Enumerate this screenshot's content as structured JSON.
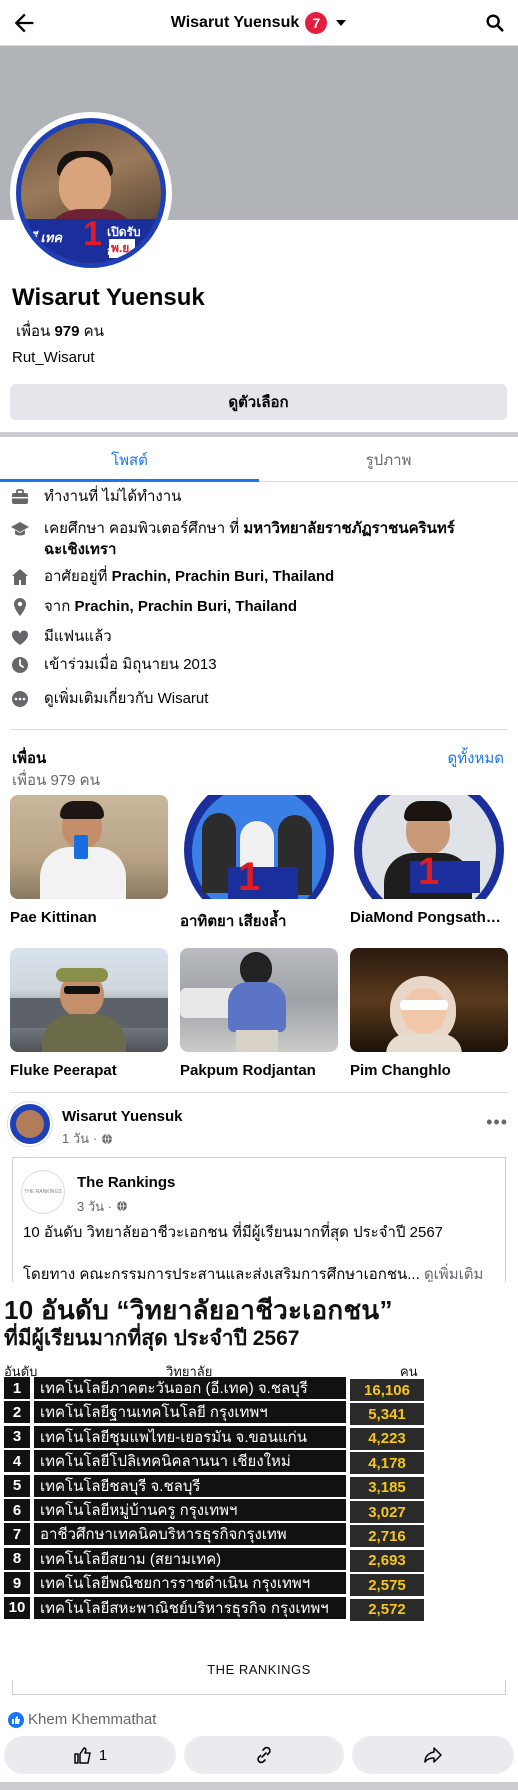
{
  "header": {
    "title": "Wisarut Yuensuk",
    "notification_count": "7"
  },
  "profile": {
    "name": "Wisarut Yuensuk",
    "friends_prefix": "เพื่อน",
    "friends_count": "979",
    "friends_suffix": "คน",
    "username": "Rut_Wisarut",
    "options_button": "ดูตัวเลือก",
    "avatar_banner": {
      "line1": "อี.เทค",
      "big": "1",
      "line2": "เปิดรับสมัคร",
      "line3": "พ.ย."
    }
  },
  "tabs": [
    {
      "label": "โพสต์",
      "active": true
    },
    {
      "label": "รูปภาพ",
      "active": false
    }
  ],
  "about": {
    "work": "ทำงานที่ ไม่ได้ทำงาน",
    "edu_prefix": "เคยศึกษา คอมพิวเตอร์ศึกษา ที่ ",
    "edu_school": "มหาวิทยาลัยราชภัฏราชนครินทร์ ฉะเชิงเทรา",
    "lives_prefix": "อาศัยอยู่ที่ ",
    "lives_place": "Prachin, Prachin Buri, Thailand",
    "from_prefix": "จาก ",
    "from_place": "Prachin, Prachin Buri, Thailand",
    "relationship": "มีแฟนแล้ว",
    "joined": "เข้าร่วมเมื่อ มิถุนายน 2013",
    "see_more": "ดูเพิ่มเติมเกี่ยวกับ Wisarut"
  },
  "friends_section": {
    "title": "เพื่อน",
    "count_text": "เพื่อน 979 คน",
    "see_all": "ดูทั้งหมด",
    "friends": [
      {
        "name": "Pae Kittinan"
      },
      {
        "name": "อาทิตยา เสียงล้ำ"
      },
      {
        "name": "DiaMond Pongsathorn"
      },
      {
        "name": "Fluke Peerapat"
      },
      {
        "name": "Pakpum Rodjantan"
      },
      {
        "name": "Pim Changhlo"
      }
    ]
  },
  "post": {
    "author": "Wisarut Yuensuk",
    "time": "1 วัน",
    "shared": {
      "author": "The Rankings",
      "time": "3 วัน",
      "avatar_text": "THE RANKINGS",
      "text1": "10 อันดับ วิทยาลัยอาชีวะเอกชน ที่มีผู้เรียนมากที่สุด ประจำปี 2567",
      "text2": "โดยทาง คณะกรรมการประสานและส่งเสริมการศึกษาเอกชน...",
      "see_more": "ดูเพิ่มเติม"
    },
    "image": {
      "heading1": "10 อันดับ “วิทยาลัยอาชีวะเอกชน”",
      "heading2": "ที่มีผู้เรียนมากที่สุด ประจำปี 2567",
      "col_rank": "อันดับ",
      "col_name": "วิทยาลัย",
      "col_count": "คน",
      "brand": "THE RANKINGS",
      "rows": [
        {
          "rank": "1",
          "name": "เทคโนโลยีภาคตะวันออก (อี.เทค) จ.ชลบุรี",
          "count": "16,106"
        },
        {
          "rank": "2",
          "name": "เทคโนโลยีฐานเทคโนโลยี กรุงเทพฯ",
          "count": "5,341"
        },
        {
          "rank": "3",
          "name": "เทคโนโลยีชุมแพไทย-เยอรมัน จ.ขอนแก่น",
          "count": "4,223"
        },
        {
          "rank": "4",
          "name": "เทคโนโลยีโปลิเทคนิคลานนา เชียงใหม่",
          "count": "4,178"
        },
        {
          "rank": "5",
          "name": "เทคโนโลยีชลบุรี จ.ชลบุรี",
          "count": "3,185"
        },
        {
          "rank": "6",
          "name": "เทคโนโลยีหมู่บ้านครู กรุงเทพฯ",
          "count": "3,027"
        },
        {
          "rank": "7",
          "name": "อาชีวศึกษาเทคนิคบริหารธุรกิจกรุงเทพ",
          "count": "2,716"
        },
        {
          "rank": "8",
          "name": "เทคโนโลยีสยาม (สยามเทค)",
          "count": "2,693"
        },
        {
          "rank": "9",
          "name": "เทคโนโลยีพณิชยการราชดำเนิน กรุงเทพฯ",
          "count": "2,575"
        },
        {
          "rank": "10",
          "name": "เทคโนโลยีสหะพาณิชย์บริหารธุรกิจ กรุงเทพฯ",
          "count": "2,572"
        }
      ]
    },
    "reactor": "Khem Khemmathat",
    "like_count": "1"
  },
  "colors": {
    "accent": "#1877f2",
    "badge": "#e41e3f",
    "cover": "#b0b3b8",
    "rank_value": "#f5c518"
  },
  "icons": [
    "back-arrow-icon",
    "caret-down-icon",
    "search-icon",
    "briefcase-icon",
    "graduation-cap-icon",
    "home-icon",
    "location-pin-icon",
    "heart-icon",
    "clock-icon",
    "more-dots-icon",
    "globe-icon",
    "like-icon",
    "link-icon",
    "share-icon"
  ]
}
